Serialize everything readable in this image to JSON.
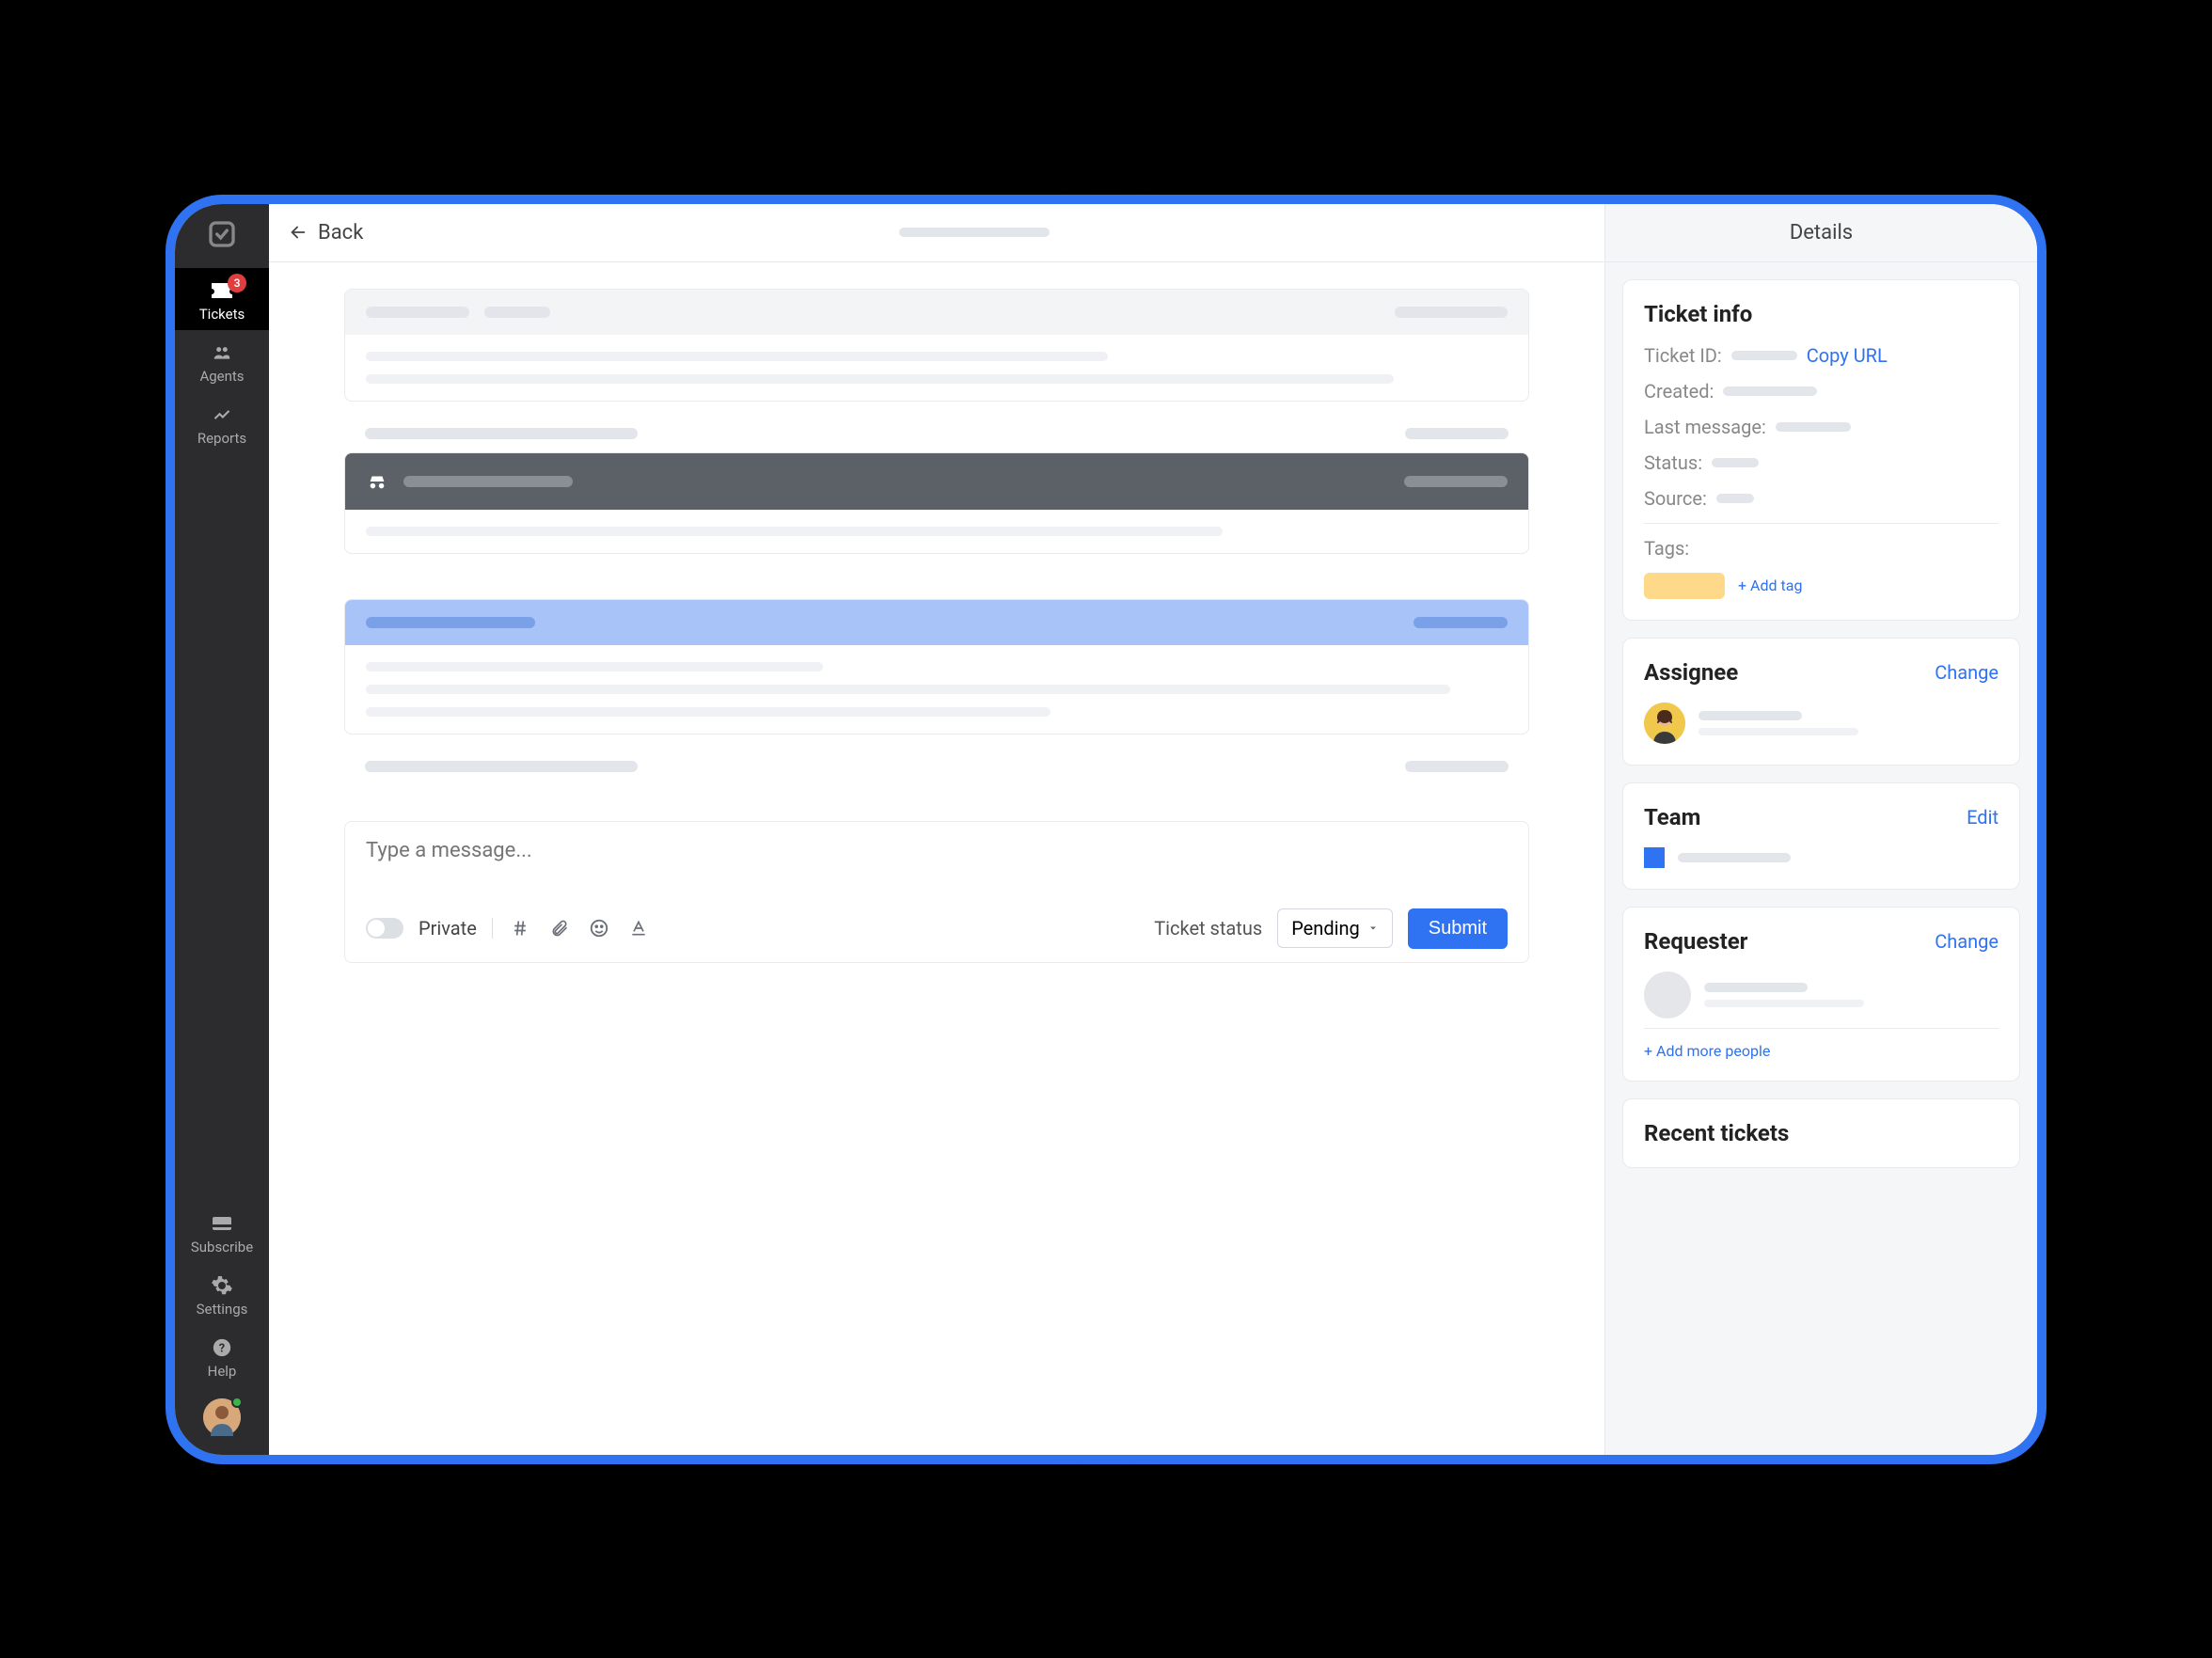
{
  "sidebar": {
    "items": [
      {
        "label": "Tickets",
        "badge": "3"
      },
      {
        "label": "Agents"
      },
      {
        "label": "Reports"
      }
    ],
    "bottom": [
      {
        "label": "Subscribe"
      },
      {
        "label": "Settings"
      },
      {
        "label": "Help"
      }
    ]
  },
  "topbar": {
    "back": "Back"
  },
  "composer": {
    "placeholder": "Type a message...",
    "private_label": "Private",
    "status_label": "Ticket status",
    "status_value": "Pending",
    "submit": "Submit"
  },
  "details": {
    "title": "Details",
    "ticket_info": {
      "title": "Ticket info",
      "id_label": "Ticket ID:",
      "copy_url": "Copy URL",
      "created_label": "Created:",
      "last_msg_label": "Last message:",
      "status_label": "Status:",
      "source_label": "Source:",
      "tags_label": "Tags:",
      "add_tag": "+ Add tag"
    },
    "assignee": {
      "title": "Assignee",
      "action": "Change"
    },
    "team": {
      "title": "Team",
      "action": "Edit"
    },
    "requester": {
      "title": "Requester",
      "action": "Change",
      "add_more": "+ Add more people"
    },
    "recent": {
      "title": "Recent tickets"
    }
  },
  "colors": {
    "accent": "#2f72f2",
    "badge": "#e03e3e",
    "tag": "#ffd98a"
  }
}
